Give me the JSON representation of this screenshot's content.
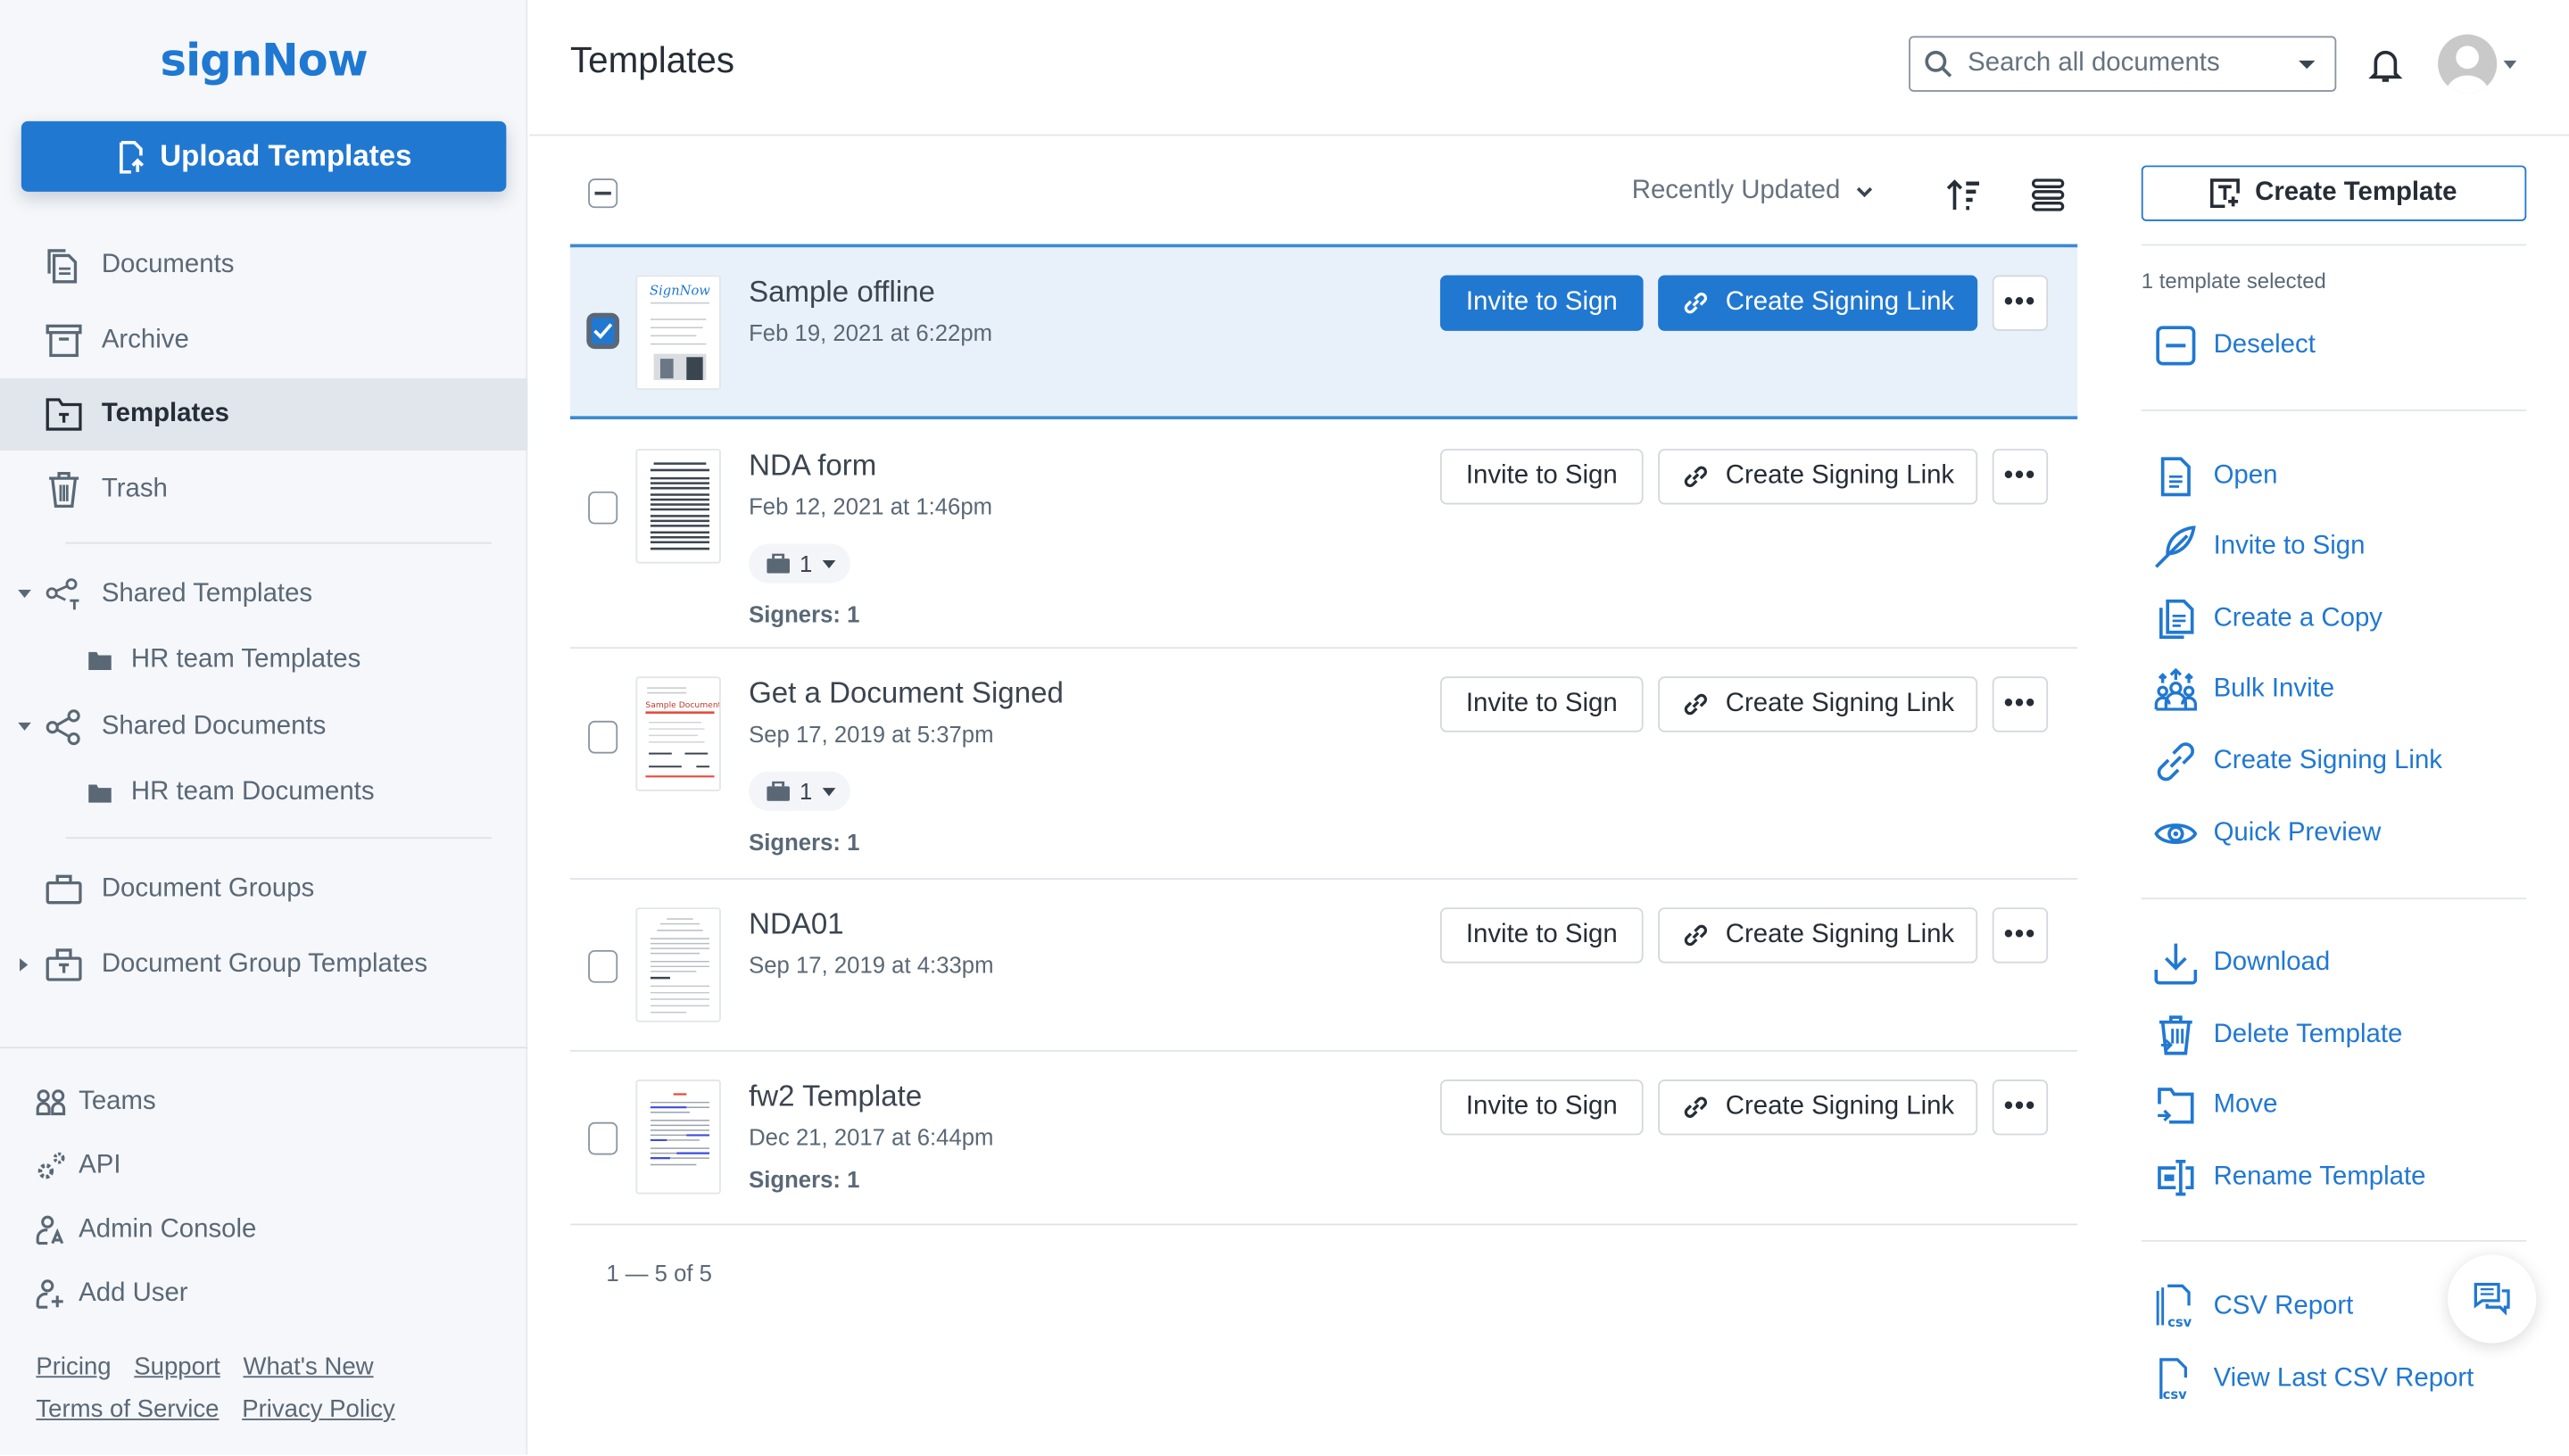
{
  "brand": {
    "logo": "signNow",
    "accent": "#2178d1"
  },
  "sidebar": {
    "upload_label": "Upload Templates",
    "nav": [
      {
        "label": "Documents",
        "icon": "documents-icon"
      },
      {
        "label": "Archive",
        "icon": "archive-icon"
      },
      {
        "label": "Templates",
        "icon": "templates-folder-icon",
        "active": true
      },
      {
        "label": "Trash",
        "icon": "trash-icon"
      }
    ],
    "shared": [
      {
        "label": "Shared Templates",
        "icon": "share-template-icon",
        "expanded": true,
        "children": [
          {
            "label": "HR team Templates"
          }
        ]
      },
      {
        "label": "Shared Documents",
        "icon": "share-icon",
        "expanded": true,
        "children": [
          {
            "label": "HR team Documents"
          }
        ]
      }
    ],
    "groups": [
      {
        "label": "Document Groups",
        "icon": "briefcase-icon"
      },
      {
        "label": "Document Group Templates",
        "icon": "briefcase-template-icon",
        "collapsed": true
      }
    ],
    "utilities": [
      {
        "label": "Teams",
        "icon": "teams-icon"
      },
      {
        "label": "API",
        "icon": "gears-icon"
      },
      {
        "label": "Admin Console",
        "icon": "admin-user-icon"
      },
      {
        "label": "Add User",
        "icon": "add-user-icon"
      }
    ],
    "footer_links": [
      "Pricing",
      "Support",
      "What's New",
      "Terms of Service",
      "Privacy Policy"
    ]
  },
  "header": {
    "title": "Templates",
    "search_placeholder": "Search all documents"
  },
  "toolbar": {
    "sort_label": "Recently Updated"
  },
  "templates": [
    {
      "name": "Sample offline",
      "date": "Feb 19, 2021 at 6:22pm",
      "selected": true,
      "roles": null,
      "signers": null
    },
    {
      "name": "NDA form",
      "date": "Feb 12, 2021 at 1:46pm",
      "selected": false,
      "roles": "1",
      "signers": "Signers: 1"
    },
    {
      "name": "Get a Document Signed",
      "date": "Sep 17, 2019 at 5:37pm",
      "selected": false,
      "roles": "1",
      "signers": "Signers: 1"
    },
    {
      "name": "NDA01",
      "date": "Sep 17, 2019 at 4:33pm",
      "selected": false,
      "roles": null,
      "signers": null
    },
    {
      "name": "fw2 Template",
      "date": "Dec 21, 2017 at 6:44pm",
      "selected": false,
      "roles": null,
      "signers": "Signers: 1"
    }
  ],
  "row_actions": {
    "invite": "Invite to Sign",
    "link": "Create Signing Link",
    "more": "•••"
  },
  "pager": "1 — 5 of 5",
  "right_panel": {
    "create_label": "Create Template",
    "selected_count": "1 template selected",
    "deselect": "Deselect",
    "actions_primary": [
      {
        "label": "Open",
        "icon": "open-document-icon"
      },
      {
        "label": "Invite to Sign",
        "icon": "feather-icon"
      },
      {
        "label": "Create a Copy",
        "icon": "copy-icon"
      },
      {
        "label": "Bulk Invite",
        "icon": "bulk-invite-icon"
      },
      {
        "label": "Create Signing Link",
        "icon": "link-icon"
      },
      {
        "label": "Quick Preview",
        "icon": "eye-icon"
      }
    ],
    "actions_secondary": [
      {
        "label": "Download",
        "icon": "download-icon"
      },
      {
        "label": "Delete Template",
        "icon": "delete-icon"
      },
      {
        "label": "Move",
        "icon": "move-folder-icon"
      },
      {
        "label": "Rename Template",
        "icon": "rename-icon"
      }
    ],
    "actions_reports": [
      {
        "label": "CSV Report",
        "icon": "csv-report-icon"
      },
      {
        "label": "View Last CSV Report",
        "icon": "csv-file-icon"
      }
    ]
  }
}
